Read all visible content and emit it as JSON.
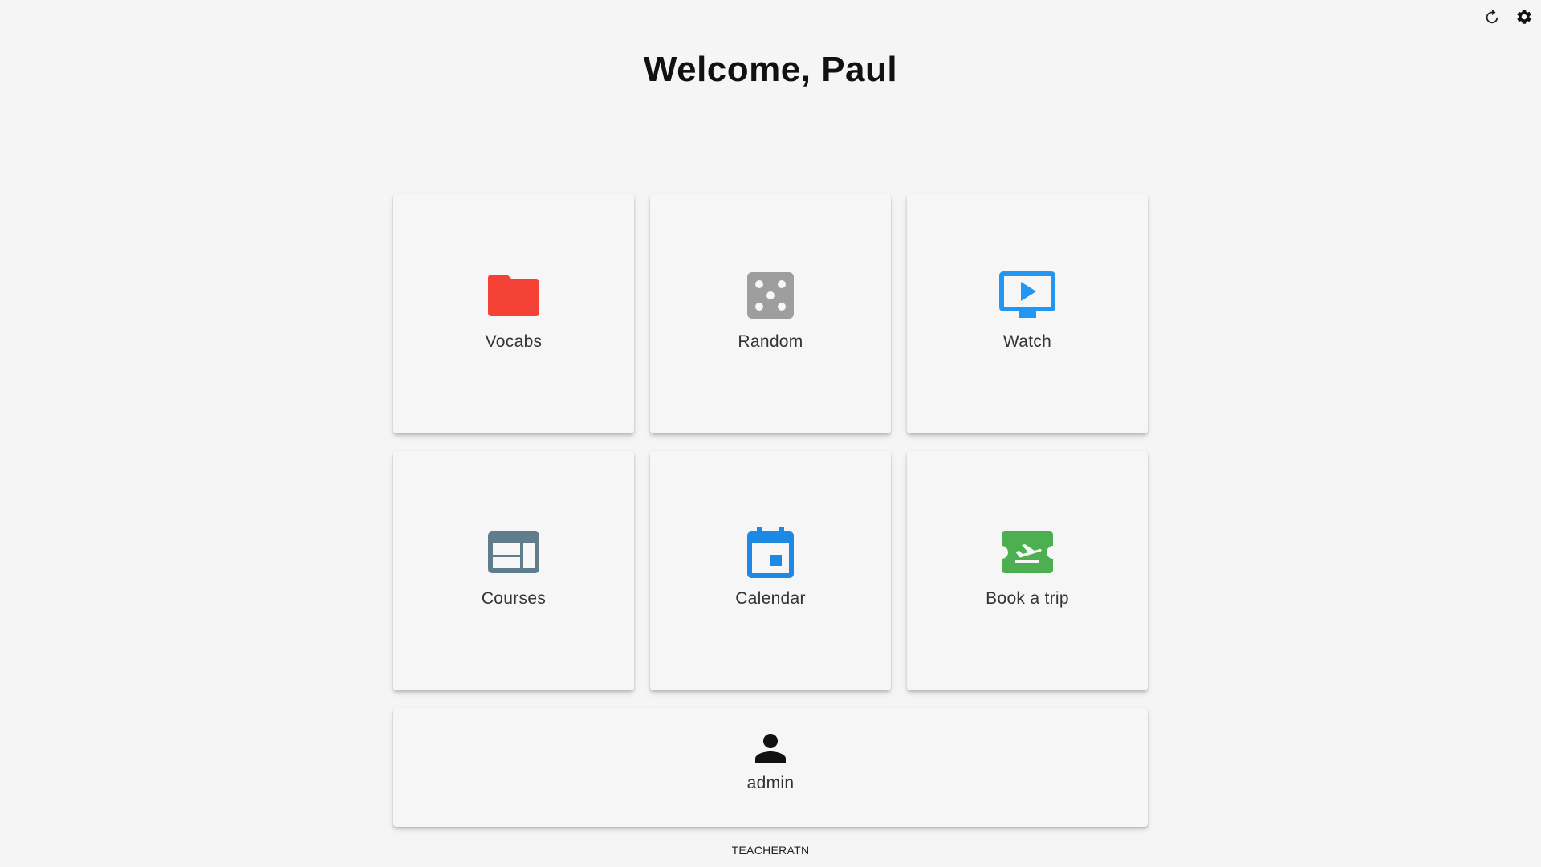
{
  "header": {
    "title": "Welcome, Paul",
    "actions": [
      {
        "icon": "refresh-icon"
      },
      {
        "icon": "gear-icon"
      }
    ]
  },
  "tiles": [
    {
      "label": "Vocabs",
      "icon": "folder-icon",
      "color": "#f44336"
    },
    {
      "label": "Random",
      "icon": "dice-icon",
      "color": "#9e9e9e"
    },
    {
      "label": "Watch",
      "icon": "play-screen-icon",
      "color": "#2196f3"
    },
    {
      "label": "Courses",
      "icon": "web-layout-icon",
      "color": "#607d8b"
    },
    {
      "label": "Calendar",
      "icon": "calendar-icon",
      "color": "#1e88e5"
    },
    {
      "label": "Book a trip",
      "icon": "airplane-ticket-icon",
      "color": "#4caf50"
    }
  ],
  "user_tile": {
    "label": "admin",
    "icon": "person-icon",
    "color": "#111111"
  },
  "footer": {
    "text": "TEACHERATN"
  }
}
